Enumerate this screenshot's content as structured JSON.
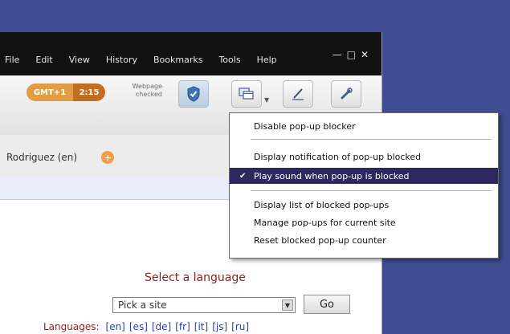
{
  "menubar": {
    "items": [
      "File",
      "Edit",
      "View",
      "History",
      "Bookmarks",
      "Tools",
      "Help"
    ]
  },
  "window_controls": {
    "minimize": "—",
    "maximize": "□",
    "close": "✕"
  },
  "toolbar": {
    "badge_left": "GMT+1",
    "badge_right": "2:15",
    "status_line1": "Webpage",
    "status_line2": "checked",
    "icons": [
      "shield-icon",
      "popup-icon",
      "pencil-icon",
      "wrench-icon"
    ]
  },
  "tab": {
    "label": "Rodriguez (en)",
    "add_label": "+"
  },
  "page": {
    "heading": "Select a language",
    "select_value": "Pick a site",
    "go_label": "Go",
    "languages_label": "Languages:",
    "languages": [
      "[en]",
      "[es]",
      "[de]",
      "[fr]",
      "[it]",
      "[js]",
      "[ru]"
    ]
  },
  "popup_menu": {
    "items": [
      {
        "label": "Disable pop-up blocker",
        "checked": false,
        "selected": false
      },
      {
        "label": "Display notification of pop-up blocked",
        "checked": false,
        "selected": false
      },
      {
        "label": "Play sound when pop-up is blocked",
        "checked": true,
        "selected": true
      },
      {
        "label": "Display list of blocked pop-ups",
        "checked": false,
        "selected": false
      },
      {
        "label": "Manage pop-ups for current site",
        "checked": false,
        "selected": false
      },
      {
        "label": "Reset blocked pop-up counter",
        "checked": false,
        "selected": false
      }
    ]
  },
  "colors": {
    "desktop": "#3f4c91",
    "menu_highlight": "#2e2860",
    "badge_orange": "#e29d44"
  }
}
